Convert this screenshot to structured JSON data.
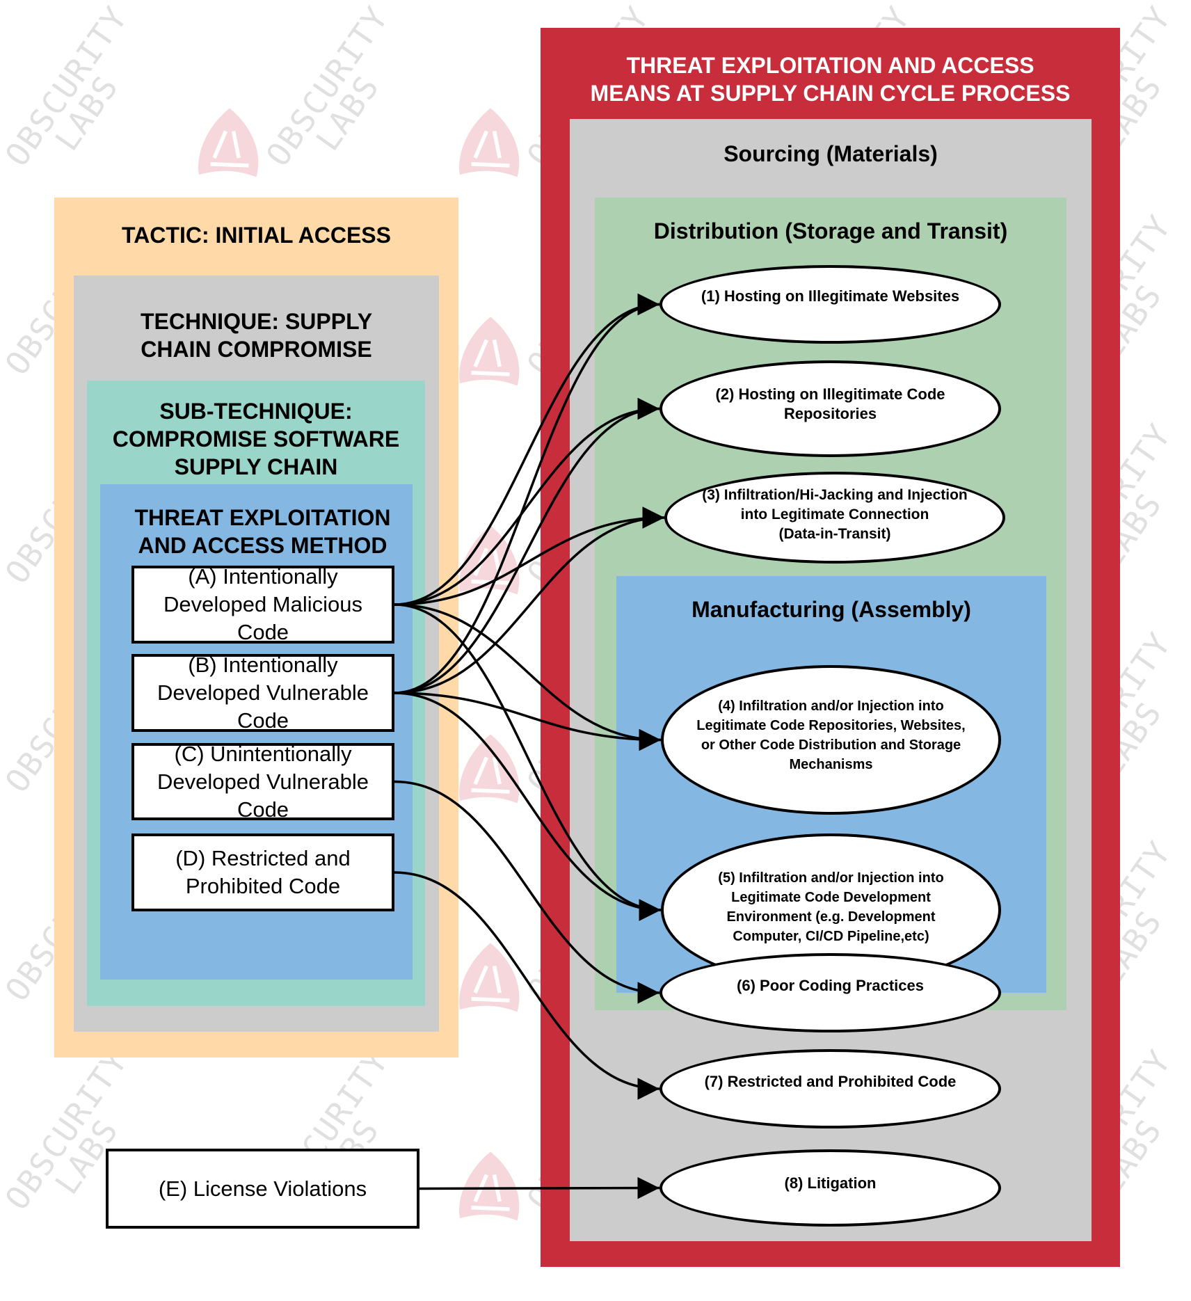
{
  "watermark": {
    "text_line1": "OBSCURITY",
    "text_line2": "LABS",
    "logo_icon": "shield-logo-icon"
  },
  "colors": {
    "tactic_bg": "#FFDAA8",
    "technique_bg": "#CCCCCC",
    "subtechnique_bg": "#9AD5CA",
    "method_bg": "#84B8E2",
    "process_frame": "#C82D3B",
    "sourcing_bg": "#CCCCCC",
    "distribution_bg": "#ADD1B0",
    "manufacturing_bg": "#84B8E2",
    "edge": "#000000"
  },
  "left": {
    "tactic_title": "TACTIC: INITIAL ACCESS",
    "technique_title_line1": "TECHNIQUE: SUPPLY",
    "technique_title_line2": "CHAIN COMPROMISE",
    "subtechnique_title_line1": "SUB-TECHNIQUE:",
    "subtechnique_title_line2": "COMPROMISE SOFTWARE",
    "subtechnique_title_line3": "SUPPLY CHAIN",
    "method_title_line1": "THREAT EXPLOITATION",
    "method_title_line2": "AND ACCESS METHOD",
    "methods": [
      {
        "id": "A",
        "lines": [
          "(A) Intentionally",
          "Developed Malicious",
          "Code"
        ]
      },
      {
        "id": "B",
        "lines": [
          "(B) Intentionally",
          "Developed Vulnerable",
          "Code"
        ]
      },
      {
        "id": "C",
        "lines": [
          "(C) Unintentionally",
          "Developed Vulnerable",
          "Code"
        ]
      },
      {
        "id": "D",
        "lines": [
          "(D) Restricted and",
          "Prohibited Code"
        ]
      }
    ],
    "standalone": {
      "id": "E",
      "label": "(E) License Violations"
    }
  },
  "right": {
    "title_line1": "THREAT EXPLOITATION AND ACCESS",
    "title_line2": "MEANS AT SUPPLY CHAIN CYCLE PROCESS",
    "sourcing_title": "Sourcing (Materials)",
    "distribution_title": "Distribution (Storage and Transit)",
    "manufacturing_title": "Manufacturing (Assembly)",
    "means": [
      {
        "id": "1",
        "lines": [
          "(1) Hosting on Illegitimate Websites"
        ]
      },
      {
        "id": "2",
        "lines": [
          "(2) Hosting on Illegitimate Code",
          "Repositories"
        ]
      },
      {
        "id": "3",
        "lines": [
          "(3) Infiltration/Hi-Jacking and Injection",
          "into Legitimate Connection",
          "(Data-in-Transit)"
        ]
      },
      {
        "id": "4",
        "lines": [
          "(4) Infiltration and/or Injection into",
          "Legitimate Code Repositories, Websites,",
          "or Other Code Distribution and Storage",
          "Mechanisms"
        ]
      },
      {
        "id": "5",
        "lines": [
          "(5) Infiltration and/or Injection into",
          "Legitimate Code Development",
          "Environment (e.g. Development",
          "Computer, CI/CD Pipeline,etc)"
        ]
      },
      {
        "id": "6",
        "lines": [
          "(6) Poor Coding Practices"
        ]
      },
      {
        "id": "7",
        "lines": [
          "(7) Restricted and Prohibited Code"
        ]
      },
      {
        "id": "8",
        "lines": [
          "(8) Litigation"
        ]
      }
    ]
  },
  "edges": [
    {
      "from": "A",
      "to": "1"
    },
    {
      "from": "A",
      "to": "2"
    },
    {
      "from": "A",
      "to": "3"
    },
    {
      "from": "A",
      "to": "4"
    },
    {
      "from": "A",
      "to": "5"
    },
    {
      "from": "B",
      "to": "1"
    },
    {
      "from": "B",
      "to": "2"
    },
    {
      "from": "B",
      "to": "3"
    },
    {
      "from": "B",
      "to": "4"
    },
    {
      "from": "B",
      "to": "5"
    },
    {
      "from": "C",
      "to": "6"
    },
    {
      "from": "D",
      "to": "7"
    },
    {
      "from": "E",
      "to": "8"
    }
  ]
}
